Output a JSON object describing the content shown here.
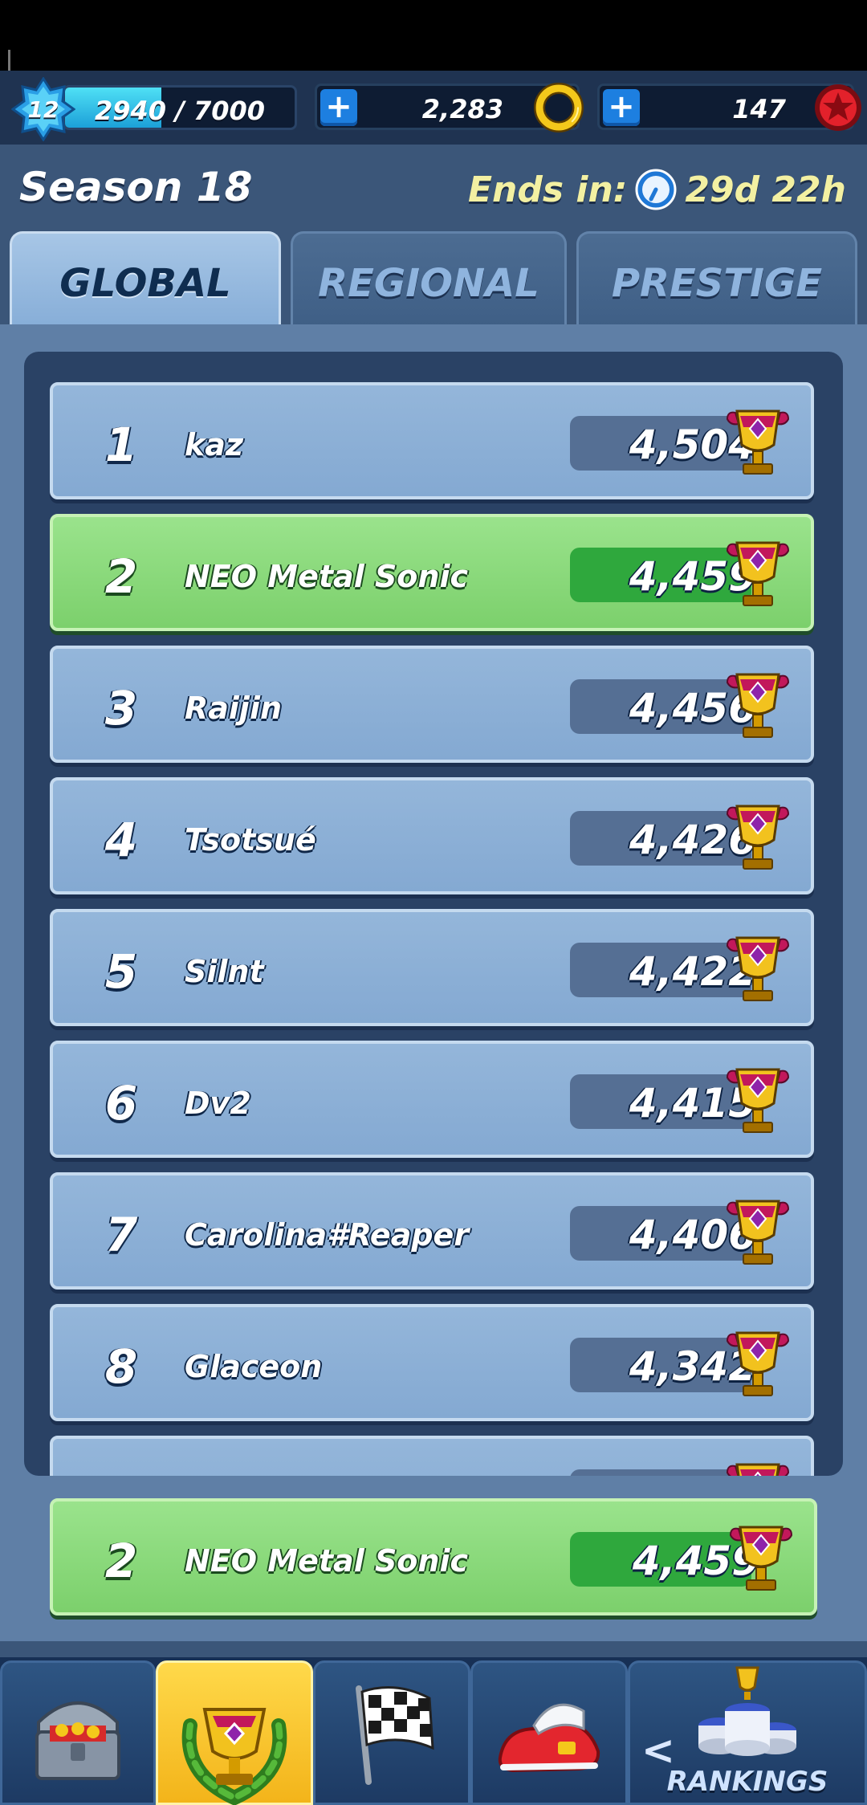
{
  "topbar": {
    "level": "12",
    "xp_text": "2940 / 7000",
    "xp_progress": 0.42,
    "rings": "2,283",
    "red_stars": "147",
    "plus_label": "+"
  },
  "season": {
    "title": "Season 18",
    "ends_label": "Ends in:",
    "ends_value": "29d 22h"
  },
  "tabs": [
    {
      "label": "GLOBAL",
      "active": true
    },
    {
      "label": "REGIONAL",
      "active": false
    },
    {
      "label": "PRESTIGE",
      "active": false
    }
  ],
  "leaderboard": [
    {
      "rank": "1",
      "name": "kaz",
      "score": "4,504"
    },
    {
      "rank": "2",
      "name": "NEO Metal Sonic",
      "score": "4,459",
      "is_player": true
    },
    {
      "rank": "3",
      "name": "Raijin",
      "score": "4,456"
    },
    {
      "rank": "4",
      "name": "Tsotsué",
      "score": "4,426"
    },
    {
      "rank": "5",
      "name": "Silnt",
      "score": "4,422"
    },
    {
      "rank": "6",
      "name": "Dv2",
      "score": "4,415"
    },
    {
      "rank": "7",
      "name": "Carolina#Reaper",
      "score": "4,406"
    },
    {
      "rank": "8",
      "name": "Glaceon",
      "score": "4,342"
    }
  ],
  "my_rank": {
    "rank": "2",
    "name": "NEO Metal Sonic",
    "score": "4,459"
  },
  "nav": {
    "items": [
      "treasure-chest",
      "trophy-laurel",
      "checkered-flag",
      "red-shoes",
      "podium"
    ],
    "rankings_label": "RANKINGS",
    "back_glyph": "<"
  },
  "colors": {
    "background": "#3b5679",
    "row_blue": "#8cb0d6",
    "row_green": "#8ada7c",
    "accent_yellow": "#f3f0a2"
  }
}
